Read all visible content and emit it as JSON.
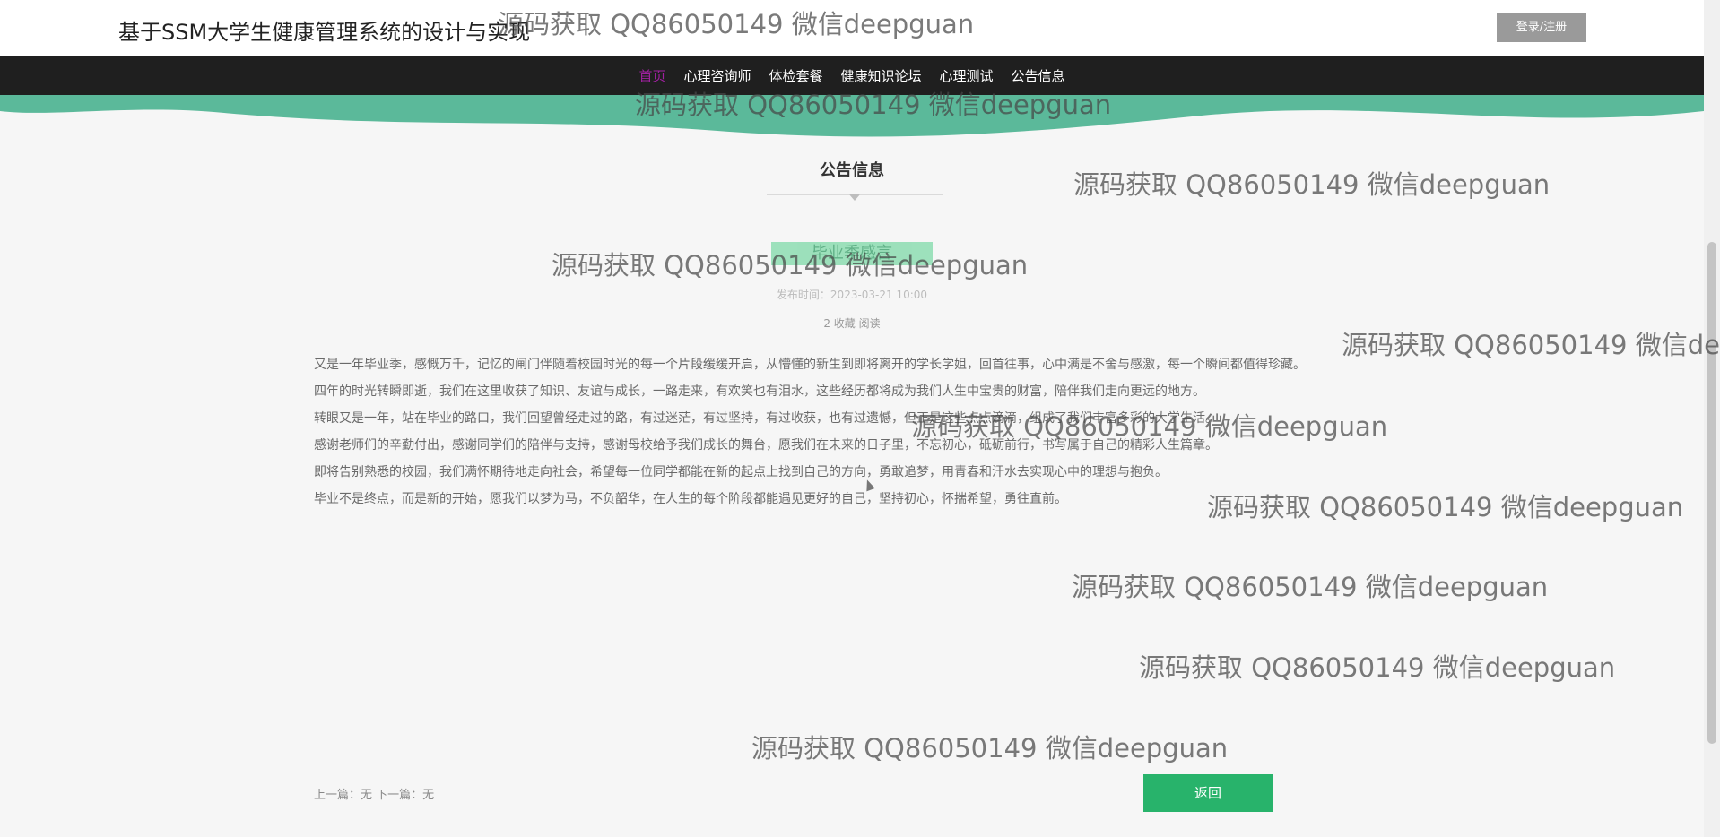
{
  "header": {
    "site_title": "基于SSM大学生健康管理系统的设计与实现",
    "login_label": "登录/注册"
  },
  "nav": {
    "items": [
      {
        "label": "首页",
        "active": true
      },
      {
        "label": "心理咨询师"
      },
      {
        "label": "体检套餐"
      },
      {
        "label": "健康知识论坛"
      },
      {
        "label": "心理测试"
      },
      {
        "label": "公告信息"
      }
    ]
  },
  "section": {
    "title": "公告信息"
  },
  "article": {
    "title": "毕业季感言",
    "date": "发布时间：2023-03-21 10:00",
    "stats": "2    收藏    阅读",
    "paragraphs": [
      "又是一年毕业季，感慨万千，记忆的闸门伴随着校园时光的每一个片段缓缓开启，从懵懂的新生到即将离开的学长学姐，回首往事，心中满是不舍与感激，每一个瞬间都值得珍藏。",
      "四年的时光转瞬即逝，我们在这里收获了知识、友谊与成长，一路走来，有欢笑也有泪水，这些经历都将成为我们人生中宝贵的财富，陪伴我们走向更远的地方。",
      "转眼又是一年，站在毕业的路口，我们回望曾经走过的路，有过迷茫，有过坚持，有过收获，也有过遗憾，但正是这些点点滴滴，组成了我们丰富多彩的大学生活。",
      "感谢老师们的辛勤付出，感谢同学们的陪伴与支持，感谢母校给予我们成长的舞台，愿我们在未来的日子里，不忘初心，砥砺前行，书写属于自己的精彩人生篇章。",
      "即将告别熟悉的校园，我们满怀期待地走向社会，希望每一位同学都能在新的起点上找到自己的方向，勇敢追梦，用青春和汗水去实现心中的理想与抱负。",
      "毕业不是终点，而是新的开始，愿我们以梦为马，不负韶华，在人生的每个阶段都能遇见更好的自己，坚持初心，怀揣希望，勇往直前。"
    ],
    "prev_label": "上一篇：无    下一篇：无"
  },
  "back_button": {
    "label": "返回"
  },
  "watermarks": [
    "源码获取 QQ86050149 微信deepguan",
    "源码获取 QQ86050149 微信deepguan",
    "源码获取 QQ86050149 微信deepguan",
    "源码获取 QQ86050149 微信deepguan",
    "源码获取 QQ86050149 微信de",
    "源码获取 QQ86050149 微信deepguan",
    "源码获取 QQ86050149 微信deepguan",
    "源码获取 QQ86050149 微信deepguan",
    "源码获取 QQ86050149 微信deepguan",
    "源码获取 QQ86050149 微信deepguan"
  ],
  "colors": {
    "nav_bg": "#1f1f1f",
    "wave": "#5bb99a",
    "accent_green": "#28b36b"
  }
}
